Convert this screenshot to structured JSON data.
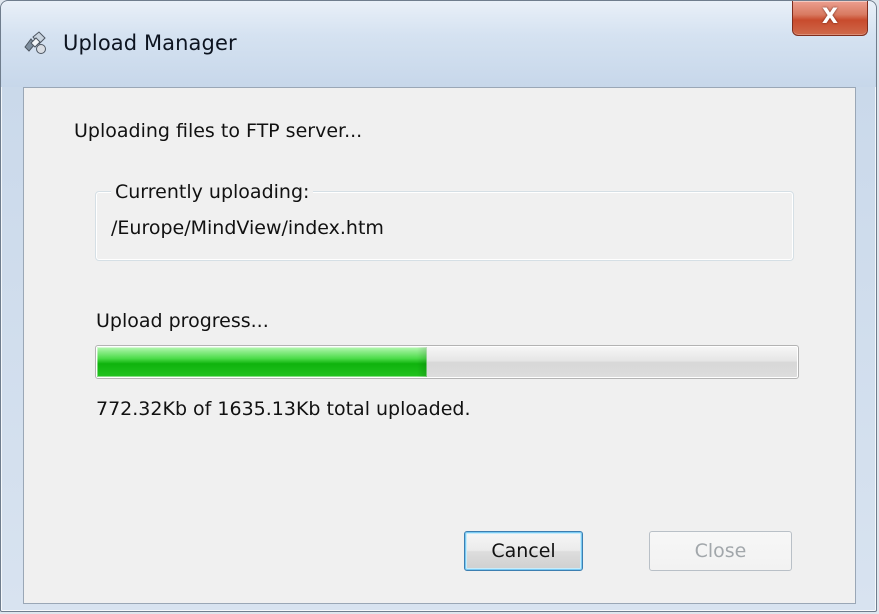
{
  "window": {
    "title": "Upload Manager",
    "title_icon": "upload-manager-icon",
    "close_icon": "close-icon",
    "close_glyph": "X"
  },
  "dialog": {
    "status_message": "Uploading files to FTP server...",
    "current_upload_caption": "Currently uploading:",
    "current_file": "/Europe/MindView/index.htm",
    "progress_label": "Upload progress...",
    "progress_fraction": 0.472,
    "progress_summary": "772.32Kb of 1635.13Kb total uploaded."
  },
  "buttons": {
    "cancel_label": "Cancel",
    "close_label": "Close"
  },
  "colors": {
    "progress_accent": "#1fbf1b",
    "focus_accent": "#3c7fb1",
    "close_button": "#c84b2d"
  }
}
